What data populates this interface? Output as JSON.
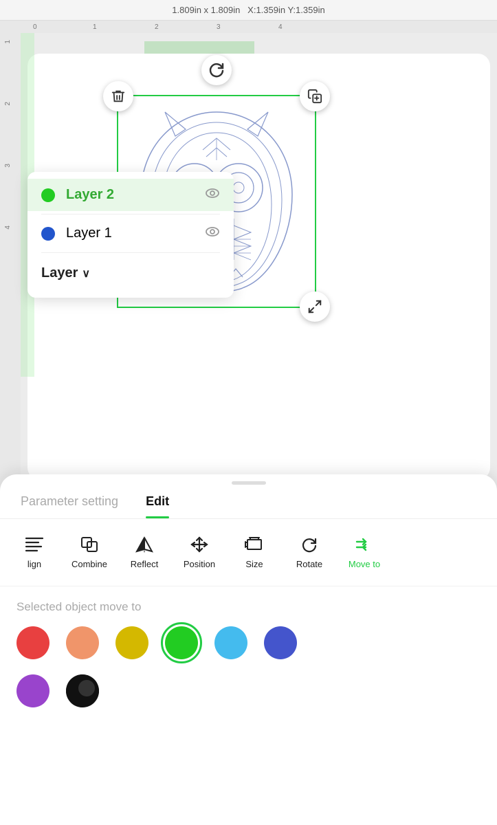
{
  "header": {
    "dimensions": "1.809in x 1.809in",
    "coordinates": "X:1.359in Y:1.359in"
  },
  "ruler": {
    "ticks": [
      "0",
      "1",
      "2",
      "3",
      "4"
    ]
  },
  "layers": [
    {
      "id": "layer2",
      "name": "Layer 2",
      "color": "#22cc22",
      "active": true
    },
    {
      "id": "layer1",
      "name": "Layer 1",
      "color": "#2255cc",
      "active": false
    }
  ],
  "layer_dropdown": {
    "label": "Layer"
  },
  "panel": {
    "tab_parameter": "Parameter setting",
    "tab_edit": "Edit",
    "active_tab": "edit"
  },
  "toolbar": {
    "items": [
      {
        "id": "align",
        "label": "lign",
        "icon": "align"
      },
      {
        "id": "combine",
        "label": "Combine",
        "icon": "combine"
      },
      {
        "id": "reflect",
        "label": "Reflect",
        "icon": "reflect"
      },
      {
        "id": "position",
        "label": "Position",
        "icon": "position"
      },
      {
        "id": "size",
        "label": "Size",
        "icon": "size"
      },
      {
        "id": "rotate",
        "label": "Rotate",
        "icon": "rotate"
      },
      {
        "id": "moveto",
        "label": "Move to",
        "icon": "moveto",
        "active": true
      }
    ]
  },
  "moveto": {
    "label": "Selected object move to",
    "colors": [
      {
        "id": "red",
        "hex": "#e84040",
        "selected": false
      },
      {
        "id": "orange",
        "hex": "#f0956a",
        "selected": false
      },
      {
        "id": "yellow",
        "hex": "#d4b800",
        "selected": false
      },
      {
        "id": "green",
        "hex": "#22cc22",
        "selected": true
      },
      {
        "id": "cyan",
        "hex": "#44bbee",
        "selected": false
      },
      {
        "id": "blue",
        "hex": "#4455cc",
        "selected": false
      }
    ],
    "colors2": [
      {
        "id": "purple",
        "hex": "#9944cc",
        "selected": false
      },
      {
        "id": "black",
        "hex": "#111111",
        "selected": false
      }
    ]
  },
  "handles": {
    "rotate": "↻",
    "delete": "🗑",
    "add": "⊞",
    "scale": "⤢"
  }
}
